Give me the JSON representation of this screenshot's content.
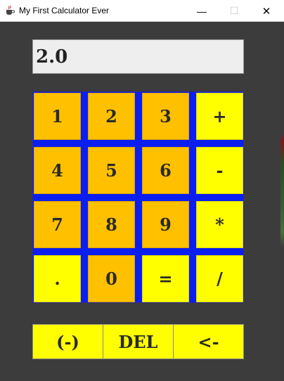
{
  "window": {
    "title": "My First Calculator Ever",
    "minimize_glyph": "—",
    "maximize_glyph": "☐",
    "close_glyph": "✕",
    "icon": "java-cup-icon"
  },
  "display": {
    "value": "2.0"
  },
  "keypad": {
    "colors": {
      "frame": "#0b1ef0",
      "digit_key": "#ffc000",
      "operator_key": "#ffff00"
    },
    "rows": [
      [
        "1",
        "2",
        "3",
        "+"
      ],
      [
        "4",
        "5",
        "6",
        "-"
      ],
      [
        "7",
        "8",
        "9",
        "*"
      ],
      [
        ".",
        "0",
        "=",
        "/"
      ]
    ]
  },
  "bottom_row": {
    "negate": "(-)",
    "delete": "DEL",
    "backspace": "<-"
  }
}
